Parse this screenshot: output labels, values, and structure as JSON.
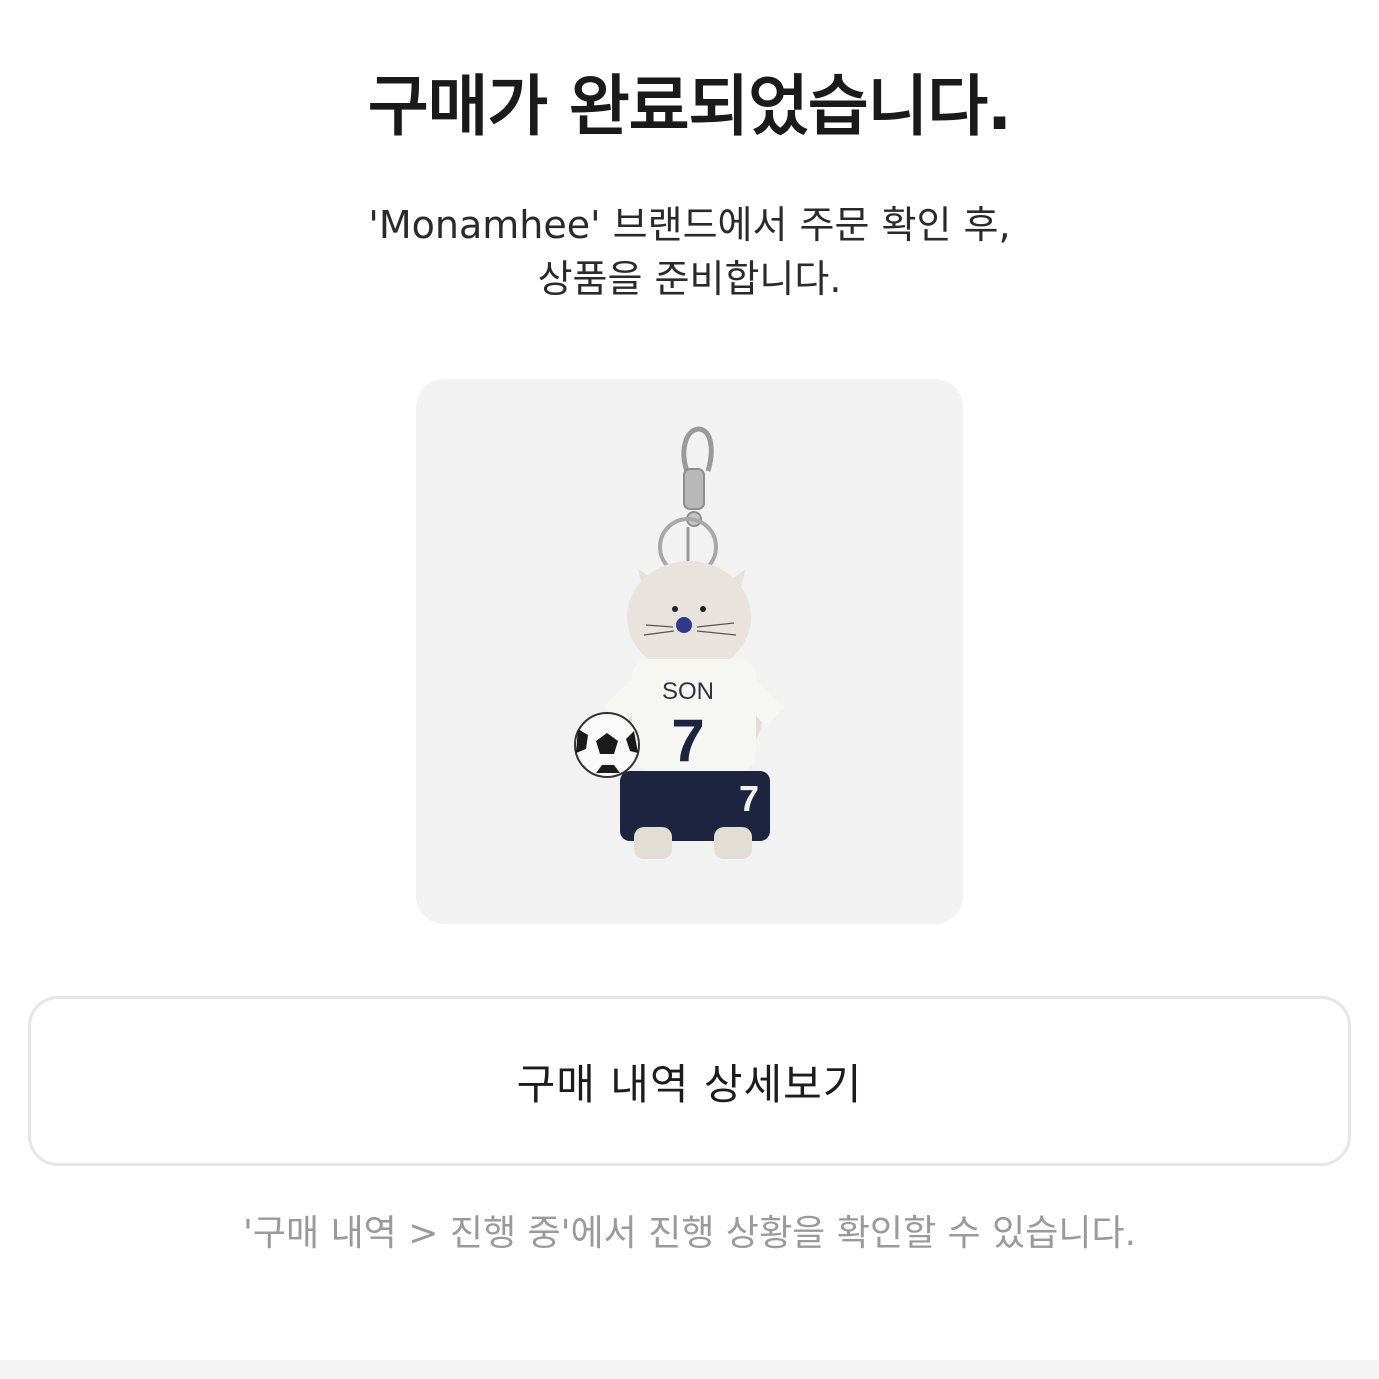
{
  "header": {
    "title": "구매가 완료되었습니다.",
    "subtitle_line1": "'Monamhee' 브랜드에서 주문 확인 후,",
    "subtitle_line2": "상품을 준비합니다."
  },
  "product": {
    "jersey_name": "SON",
    "jersey_number": "7",
    "shorts_number": "7"
  },
  "actions": {
    "detail_button_label": "구매 내역 상세보기"
  },
  "footer": {
    "hint": "'구매 내역 > 진행 중'에서 진행 상황을 확인할 수 있습니다."
  },
  "colors": {
    "card_bg": "#f2f2f2",
    "navy": "#1c2440",
    "hint_text": "#9a9a9a"
  }
}
